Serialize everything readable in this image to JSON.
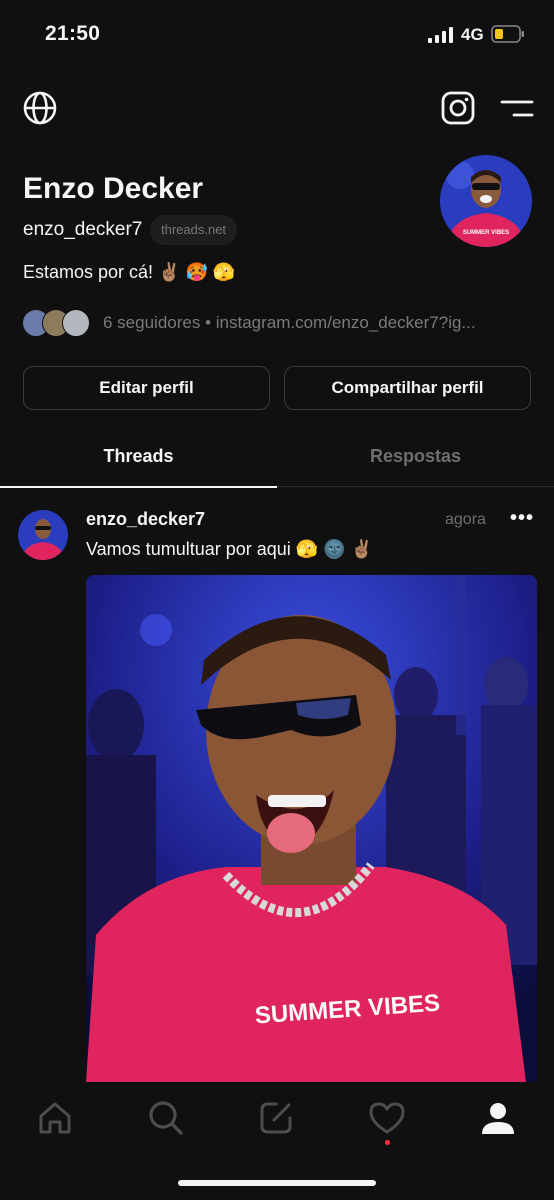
{
  "status_bar": {
    "time": "21:50",
    "network": "4G"
  },
  "top_bar": {
    "left_icon": "globe-icon",
    "right_icons": [
      "instagram-icon",
      "menu-icon"
    ]
  },
  "profile": {
    "name": "Enzo Decker",
    "handle": "enzo_decker7",
    "domain_chip": "threads.net",
    "bio": "Estamos por cá! ✌🏽 🥵 🫣",
    "followers_text": "6 seguidores • instagram.com/enzo_decker7?ig..."
  },
  "buttons": {
    "edit": "Editar perfil",
    "share": "Compartilhar perfil"
  },
  "tabs": [
    {
      "label": "Threads",
      "active": true
    },
    {
      "label": "Respostas",
      "active": false
    }
  ],
  "post": {
    "username": "enzo_decker7",
    "time": "agora",
    "more": "•••",
    "text": "Vamos tumultuar por aqui 🫣 🌚 ✌🏽",
    "shirt_text": "SUMMER VIBES"
  },
  "avatar_shirt_text": "SUMMER VIBES",
  "bottom_nav": [
    "home-icon",
    "search-icon",
    "compose-icon",
    "heart-icon",
    "profile-icon"
  ],
  "colors": {
    "background": "#101010",
    "text": "#f3f5f7",
    "muted": "#6e6e6e",
    "accent_pink": "#e0245e",
    "notification": "#ff3040"
  }
}
